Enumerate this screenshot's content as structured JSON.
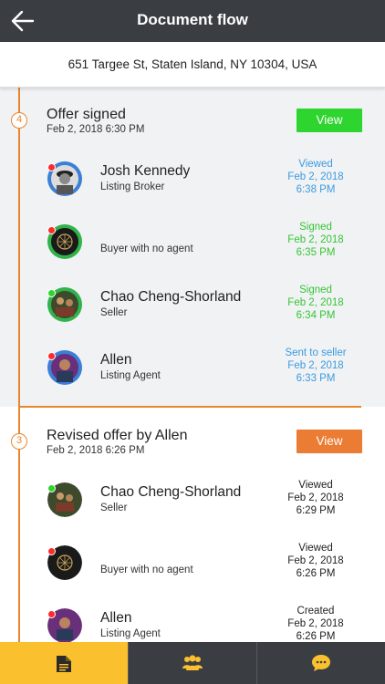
{
  "header": {
    "title": "Document flow",
    "back_icon": "arrow-left-icon"
  },
  "address": "651 Targee St, Staten Island, NY 10304, USA",
  "colors": {
    "header_bg": "#3a3e43",
    "timeline": "#e8862f",
    "view_green": "#2ed52e",
    "view_orange": "#eb7c34",
    "status_blue": "#3b9be0",
    "status_green": "#34c534",
    "active_tab": "#fbc02d",
    "notify_dot": "#ff2a2a"
  },
  "sections": [
    {
      "step": "4",
      "title": "Offer signed",
      "date": "Feb 2, 2018 6:30 PM",
      "view_label": "View",
      "parties": [
        {
          "name": "Josh Kennedy",
          "role": "Listing Broker",
          "status": [
            "Viewed",
            "Feb 2, 2018",
            "6:38 PM"
          ]
        },
        {
          "name": "",
          "role": "Buyer with no agent",
          "status": [
            "Signed",
            "Feb 2, 2018",
            "6:35 PM"
          ]
        },
        {
          "name": "Chao Cheng-Shorland",
          "role": "Seller",
          "status": [
            "Signed",
            "Feb 2, 2018",
            "6:34 PM"
          ]
        },
        {
          "name": "Allen",
          "role": "Listing Agent",
          "status": [
            "Sent to seller",
            "Feb 2, 2018",
            "6:33 PM"
          ]
        }
      ]
    },
    {
      "step": "3",
      "title": "Revised offer by Allen",
      "date": "Feb 2, 2018 6:26 PM",
      "view_label": "View",
      "parties": [
        {
          "name": "Chao Cheng-Shorland",
          "role": "Seller",
          "status": [
            "Viewed",
            "Feb 2, 2018",
            "6:29 PM"
          ]
        },
        {
          "name": "",
          "role": "Buyer with no agent",
          "status": [
            "Viewed",
            "Feb 2, 2018",
            "6:26 PM"
          ]
        },
        {
          "name": "Allen",
          "role": "Listing Agent",
          "status": [
            "Created",
            "Feb 2, 2018",
            "6:26 PM"
          ]
        }
      ]
    }
  ],
  "tabs": [
    {
      "name": "documents",
      "icon": "document-icon",
      "active": true
    },
    {
      "name": "people",
      "icon": "group-icon",
      "active": false
    },
    {
      "name": "chat",
      "icon": "chat-bubble-icon",
      "active": false
    }
  ]
}
